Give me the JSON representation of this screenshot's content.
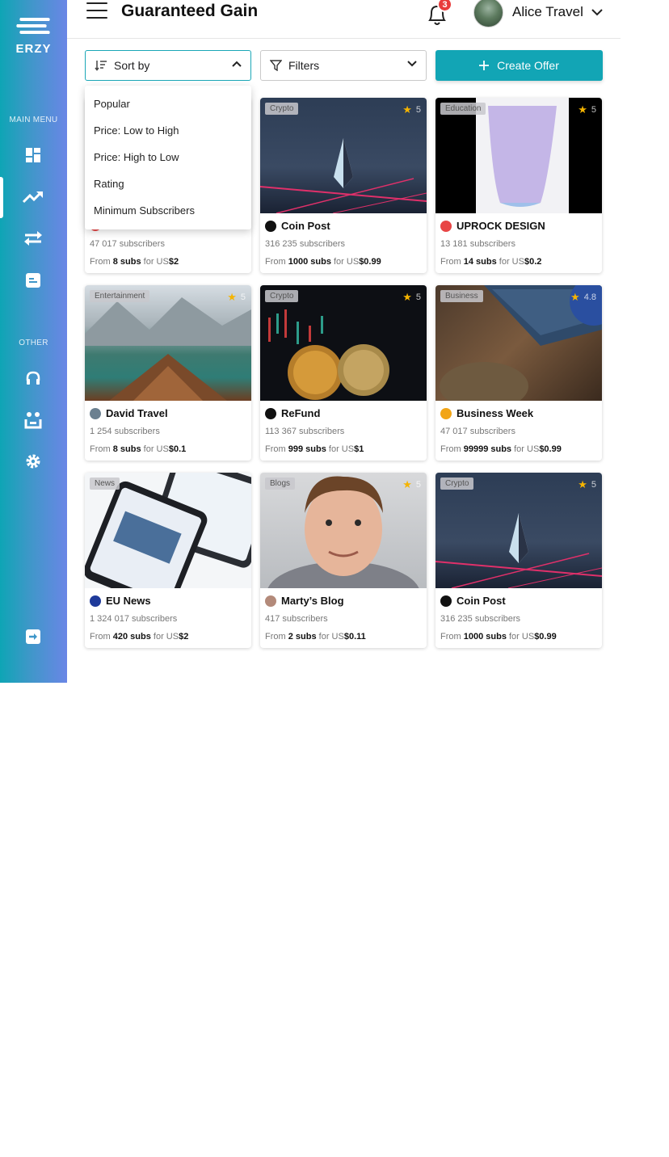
{
  "app": {
    "logo_text": "ERZY"
  },
  "sidebar": {
    "main_menu_label": "MAIN MENU",
    "other_label": "OTHER",
    "items": [
      {
        "icon": "dashboard-icon"
      },
      {
        "icon": "trending-icon",
        "active": true
      },
      {
        "icon": "transfer-icon"
      },
      {
        "icon": "ticket-icon"
      },
      {
        "icon": "headset-icon"
      },
      {
        "icon": "users-icon"
      },
      {
        "icon": "settings-icon"
      },
      {
        "icon": "logout-icon"
      }
    ]
  },
  "header": {
    "title": "Guaranteed Gain",
    "notifications_count": "3",
    "user_name": "Alice Travel"
  },
  "controls": {
    "sort_label": "Sort by",
    "filters_label": "Filters",
    "create_label": "Create Offer"
  },
  "sort_options": [
    "Popular",
    "Price: Low to High",
    "Price: High to Low",
    "Rating",
    "Minimum Subscribers"
  ],
  "cards": [
    {
      "category": "",
      "rating": "",
      "title": "",
      "subscribers": "47 017 subscribers",
      "from": "From",
      "subs": "8 subs",
      "for": "for US",
      "price": "$2",
      "icon_color": "#e84545"
    },
    {
      "category": "Crypto",
      "rating": "5",
      "title": "Coin Post",
      "subscribers": "316 235 subscribers",
      "from": "From",
      "subs": "1000 subs",
      "for": "for US",
      "price": "$0.99",
      "icon_color": "#111111"
    },
    {
      "category": "Education",
      "rating": "5",
      "title": "UPROCK DESIGN",
      "subscribers": "13 181 subscribers",
      "from": "From",
      "subs": "14 subs",
      "for": "for US",
      "price": "$0.2",
      "icon_color": "#e84545"
    },
    {
      "category": "Entertainment",
      "rating": "5",
      "title": "David Travel",
      "subscribers": "1 254 subscribers",
      "from": "From",
      "subs": "8 subs",
      "for": "for US",
      "price": "$0.1",
      "icon_color": "#6b8090"
    },
    {
      "category": "Crypto",
      "rating": "5",
      "title": "ReFund",
      "subscribers": "113 367 subscribers",
      "from": "From",
      "subs": "999 subs",
      "for": "for US",
      "price": "$1",
      "icon_color": "#111111"
    },
    {
      "category": "Business",
      "rating": "4.8",
      "title": "Business Week",
      "subscribers": "47 017 subscribers",
      "from": "From",
      "subs": "99999 subs",
      "for": "for US",
      "price": "$0.99",
      "icon_color": "#f2a516"
    },
    {
      "category": "News",
      "rating": "",
      "title": "EU News",
      "subscribers": "1 324 017 subscribers",
      "from": "From",
      "subs": "420 subs",
      "for": "for US",
      "price": "$2",
      "icon_color": "#1e3a9a"
    },
    {
      "category": "Blogs",
      "rating": "5",
      "title": "Marty’s Blog",
      "subscribers": "417 subscribers",
      "from": "From",
      "subs": "2 subs",
      "for": "for US",
      "price": "$0.11",
      "icon_color": "#b38a7a"
    },
    {
      "category": "Crypto",
      "rating": "5",
      "title": "Coin Post",
      "subscribers": "316 235 subscribers",
      "from": "From",
      "subs": "1000 subs",
      "for": "for US",
      "price": "$0.99",
      "icon_color": "#111111"
    }
  ],
  "colors": {
    "accent": "#12a5b5",
    "star": "#f5b400",
    "badge": "#e83b3b"
  }
}
